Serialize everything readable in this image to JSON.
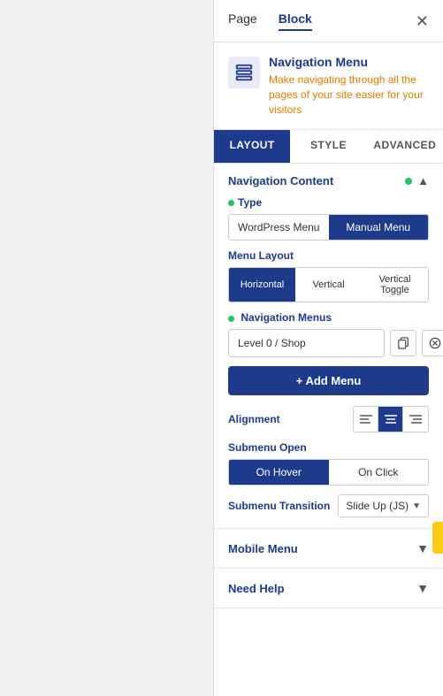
{
  "tabs": {
    "page": "Page",
    "block": "Block",
    "active": "block"
  },
  "header": {
    "icon_label": "navigation-menu-icon",
    "title": "Navigation Menu",
    "description": "Make navigating through all the pages of your site easier for your visitors"
  },
  "sub_tabs": [
    {
      "id": "layout",
      "label": "LAYOUT",
      "active": true
    },
    {
      "id": "style",
      "label": "STYLE",
      "active": false
    },
    {
      "id": "advanced",
      "label": "ADVANCED",
      "active": false
    }
  ],
  "navigation_content": {
    "section_title": "Navigation Content",
    "type_label": "Type",
    "type_options": [
      {
        "id": "wordpress",
        "label": "WordPress Menu",
        "active": false
      },
      {
        "id": "manual",
        "label": "Manual Menu",
        "active": true
      }
    ],
    "menu_layout_label": "Menu Layout",
    "menu_layout_options": [
      {
        "id": "horizontal",
        "label": "Horizontal",
        "active": true
      },
      {
        "id": "vertical",
        "label": "Vertical",
        "active": false
      },
      {
        "id": "vertical_toggle",
        "label": "Vertical Toggle",
        "active": false
      }
    ],
    "nav_menus_label": "Navigation Menus",
    "menu_value": "Level 0 / Shop",
    "menu_placeholder": "Level 0 / Shop",
    "add_menu_label": "+ Add Menu",
    "alignment_label": "Alignment",
    "align_options": [
      {
        "id": "left",
        "label": "≡",
        "active": false
      },
      {
        "id": "center",
        "label": "≡",
        "active": true
      },
      {
        "id": "right",
        "label": "≡",
        "active": false
      }
    ],
    "submenu_open_label": "Submenu Open",
    "submenu_options": [
      {
        "id": "on_hover",
        "label": "On Hover",
        "active": true
      },
      {
        "id": "on_click",
        "label": "On Click",
        "active": false
      }
    ],
    "submenu_transition_label": "Submenu Transition",
    "submenu_transition_value": "Slide Up (JS)"
  },
  "mobile_menu": {
    "title": "Mobile Menu"
  },
  "need_help": {
    "title": "Need Help"
  },
  "colors": {
    "primary": "#1e3a8a",
    "accent": "#facc15",
    "green": "#22c55e",
    "orange": "#e07c00"
  }
}
